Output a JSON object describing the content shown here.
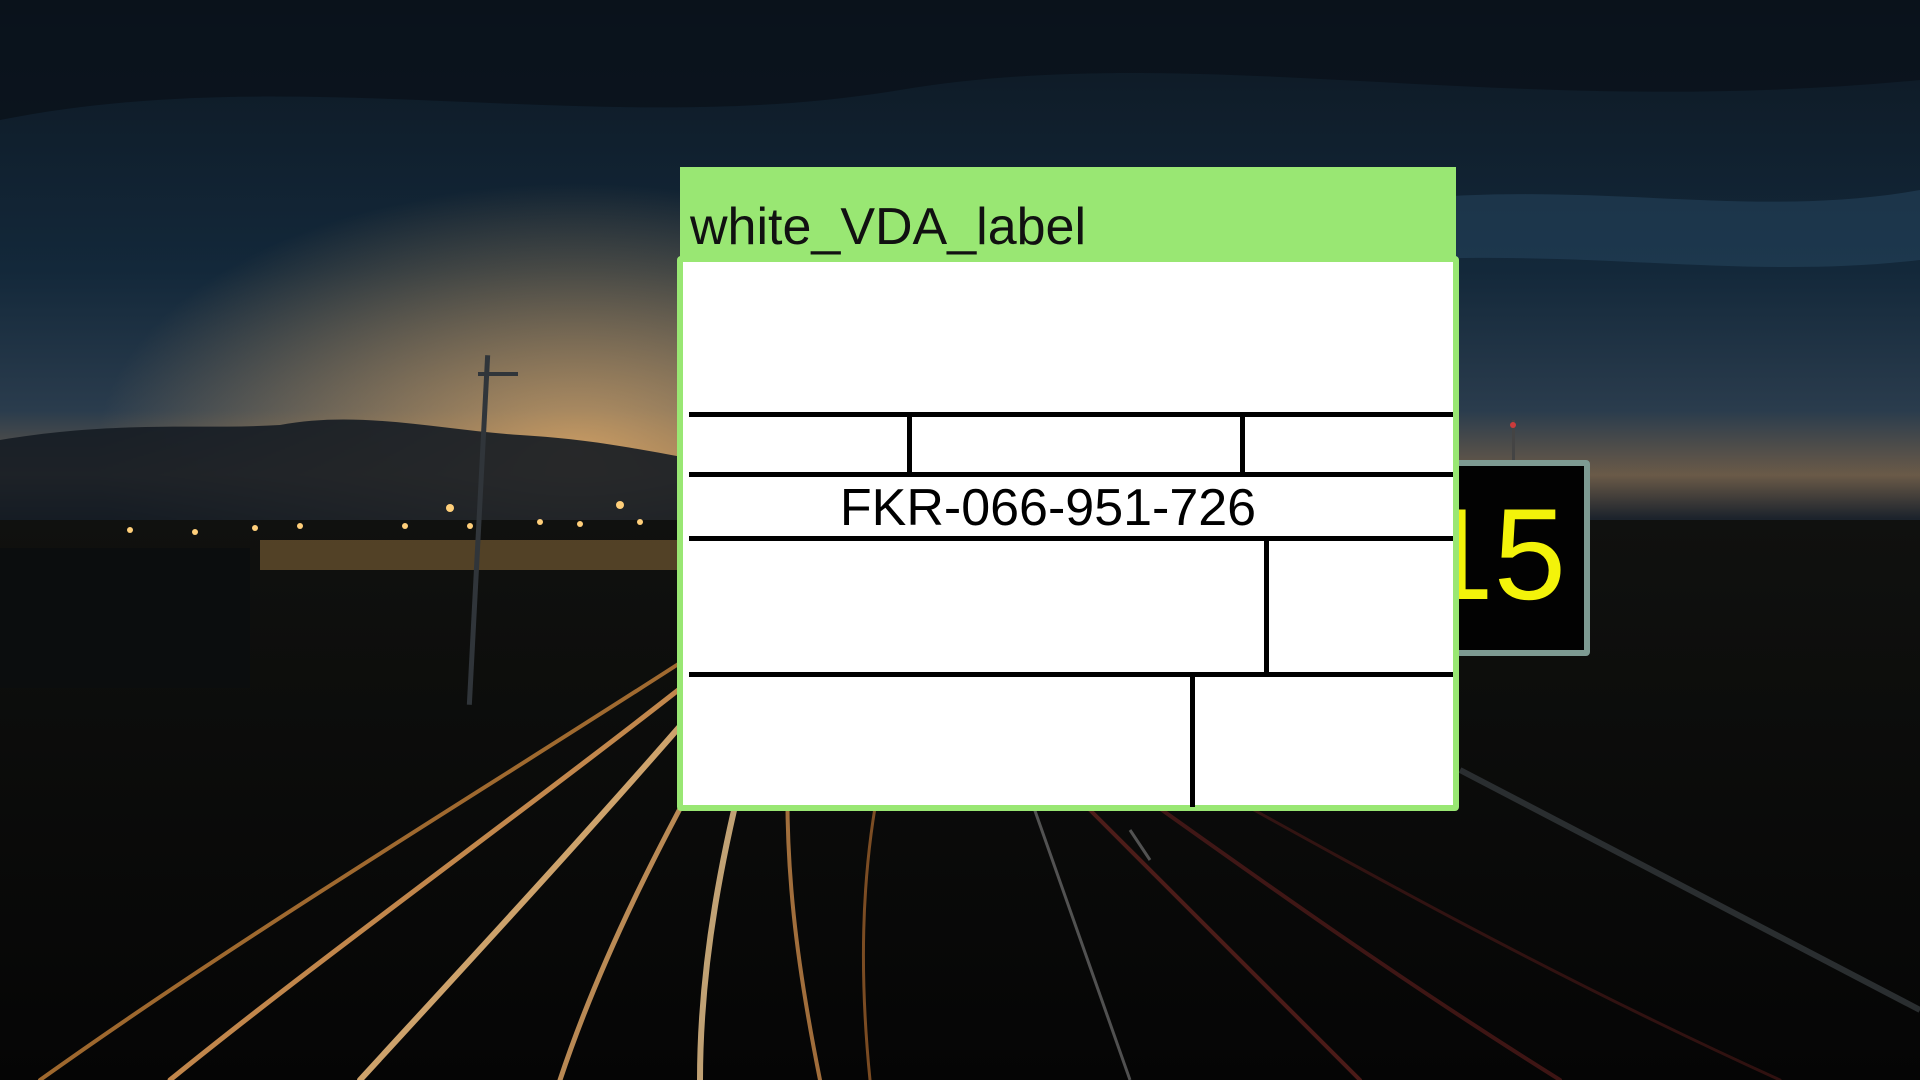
{
  "annotation": {
    "class_label": "white_VDA_label",
    "box_color": "#99e773"
  },
  "vda_label": {
    "background": "#ffffff",
    "id_text": "FKR-066-951-726"
  },
  "sign": {
    "value": "15",
    "text_color": "#f3f30a",
    "border_color": "#7d9a92"
  },
  "scene": {
    "description_icon": "highway-night-photo-icon"
  }
}
